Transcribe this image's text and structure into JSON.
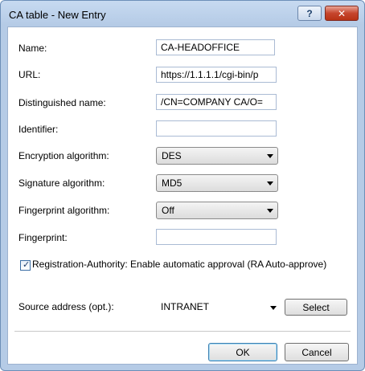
{
  "window": {
    "title": "CA table - New Entry",
    "help_label": "?",
    "close_label": "✕"
  },
  "fields": {
    "name": {
      "label": "Name:",
      "value": "CA-HEADOFFICE"
    },
    "url": {
      "label": "URL:",
      "value": "https://1.1.1.1/cgi-bin/p"
    },
    "dn": {
      "label": "Distinguished name:",
      "value": "/CN=COMPANY CA/O="
    },
    "identifier": {
      "label": "Identifier:",
      "value": ""
    },
    "encryption": {
      "label": "Encryption algorithm:",
      "value": "DES"
    },
    "signature": {
      "label": "Signature algorithm:",
      "value": "MD5"
    },
    "fingerprint_alg": {
      "label": "Fingerprint algorithm:",
      "value": "Off"
    },
    "fingerprint": {
      "label": "Fingerprint:",
      "value": ""
    }
  },
  "ra": {
    "checked": true,
    "label": "Registration-Authority: Enable automatic approval (RA Auto-approve)"
  },
  "source": {
    "label": "Source address (opt.):",
    "value": "INTRANET",
    "select_label": "Select"
  },
  "buttons": {
    "ok": "OK",
    "cancel": "Cancel"
  }
}
